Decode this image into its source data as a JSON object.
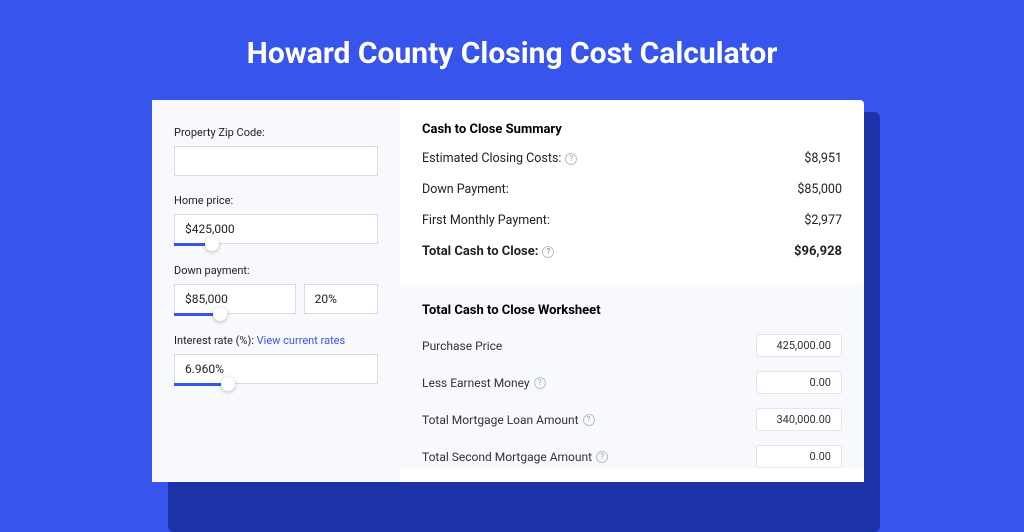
{
  "header": {
    "title": "Howard County Closing Cost Calculator"
  },
  "inputs": {
    "zip_label": "Property Zip Code:",
    "zip_value": "",
    "home_price_label": "Home price:",
    "home_price_value": "$425,000",
    "down_payment_label": "Down payment:",
    "down_payment_value": "$85,000",
    "down_payment_pct": "20%",
    "interest_label_pre": "Interest rate (%): ",
    "interest_link": "View current rates",
    "interest_value": "6.960%"
  },
  "summary": {
    "title": "Cash to Close Summary",
    "rows": [
      {
        "label": "Estimated Closing Costs:",
        "help": true,
        "value": "$8,951"
      },
      {
        "label": "Down Payment:",
        "help": false,
        "value": "$85,000"
      },
      {
        "label": "First Monthly Payment:",
        "help": false,
        "value": "$2,977"
      }
    ],
    "total_label": "Total Cash to Close:",
    "total_value": "$96,928"
  },
  "worksheet": {
    "title": "Total Cash to Close Worksheet",
    "rows": [
      {
        "label": "Purchase Price",
        "help": false,
        "value": "425,000.00"
      },
      {
        "label": "Less Earnest Money",
        "help": true,
        "value": "0.00"
      },
      {
        "label": "Total Mortgage Loan Amount",
        "help": true,
        "value": "340,000.00"
      },
      {
        "label": "Total Second Mortgage Amount",
        "help": true,
        "value": "0.00"
      }
    ]
  }
}
